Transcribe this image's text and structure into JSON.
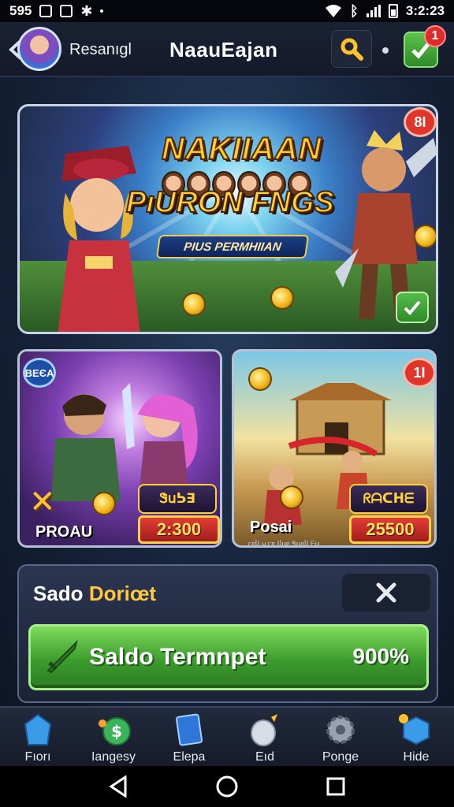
{
  "status_bar": {
    "left_text": "595",
    "time": "3:2:23",
    "icons": [
      "gallery-icon",
      "gallery-icon",
      "settings-icon",
      "wifi-icon",
      "bluetooth-icon",
      "signal-icon",
      "battery-icon"
    ]
  },
  "header": {
    "username": "Resanıgl",
    "title": "NaauEajan",
    "notification_count": "1",
    "icons": [
      "back-chevron-icon",
      "avatar",
      "search-icon",
      "check-icon"
    ]
  },
  "hero": {
    "title": "NAKIIAAN",
    "subtitle": "PıURON FNGS",
    "ribbon": "PIUS PERMHIIAN",
    "badge": "8I"
  },
  "cards": [
    {
      "label": "PROAU",
      "corner_badge": "BEЄA",
      "top_tag": "Ꮥ𝗎ᕊ∃",
      "price": "2:300"
    },
    {
      "label": "Posai",
      "sublabel": "ᥴᥱᥣꙆ ᥕ ᥴᥲ Ꙇᥣ𝗎ᥱ Ꮥ𝗎ᥲᥣꙆ ᖴ𝗎",
      "corner_badge": "1I",
      "top_tag": "ᖇᗩᑕᕼᗴ",
      "price": "25500"
    }
  ],
  "saldo": {
    "title_part1": "Sado",
    "title_part2": "Doriœt",
    "bar_label": "Saldo Termnpet",
    "bar_value": "900%"
  },
  "bottom_nav": [
    {
      "label": "Fıorı",
      "icon": "crystal-icon"
    },
    {
      "label": "Iangesy",
      "icon": "dollar-icon"
    },
    {
      "label": "Elepa",
      "icon": "card-icon"
    },
    {
      "label": "Eıd",
      "icon": "egg-icon"
    },
    {
      "label": "Ponge",
      "icon": "gear-icon"
    },
    {
      "label": "Hide",
      "icon": "cube-icon"
    }
  ],
  "colors": {
    "accent_green": "#4caf3f",
    "accent_gold": "#ffc83d",
    "badge_red": "#e0352b",
    "panel_bg": "#222a3d"
  }
}
